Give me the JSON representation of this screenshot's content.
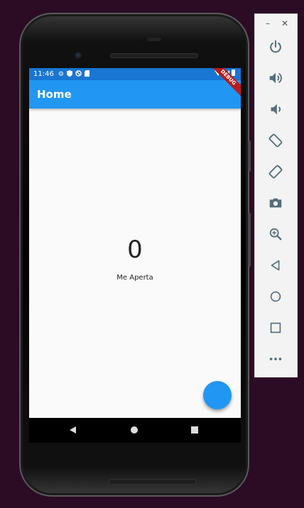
{
  "status_bar": {
    "time": "11:46",
    "icons": [
      "gear-icon",
      "shield-icon",
      "no-sync-icon",
      "sd-card-icon",
      "wifi-icon",
      "signal-icon",
      "battery-icon"
    ]
  },
  "app_bar": {
    "title": "Home"
  },
  "debug_banner": {
    "text": "DEBUG"
  },
  "main": {
    "counter_value": "0",
    "caption": "Me Aperta"
  },
  "fab": {
    "icon": "none"
  },
  "nav_bar": {
    "items": [
      "back",
      "home",
      "recents"
    ]
  },
  "emulator_toolbar": {
    "window_controls": [
      "minimize",
      "close"
    ],
    "minimize_glyph": "–",
    "close_glyph": "✕",
    "buttons": [
      "power",
      "volume-up",
      "volume-down",
      "rotate-left",
      "rotate-right",
      "screenshot",
      "zoom",
      "back",
      "home",
      "overview",
      "more"
    ]
  },
  "colors": {
    "primary": "#2196f3",
    "status_bar": "#1976d2",
    "background": "#2c0b24",
    "debug": "#b71c1c"
  }
}
